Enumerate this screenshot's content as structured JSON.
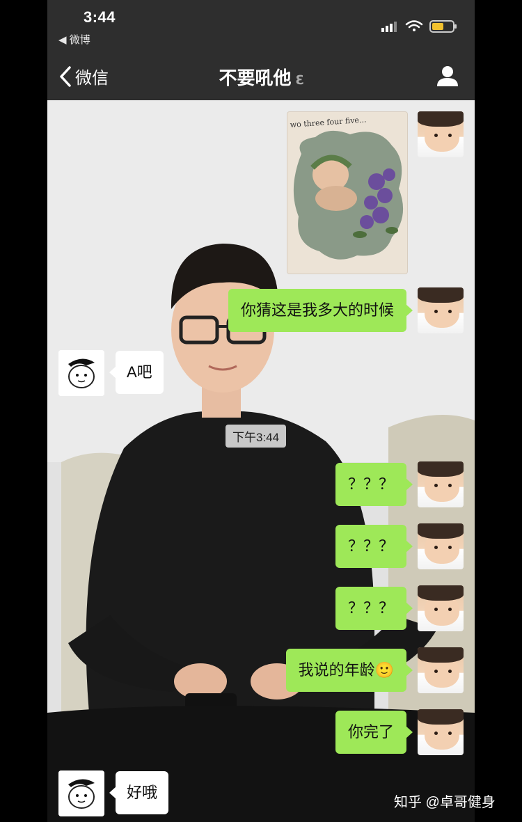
{
  "status_bar": {
    "time": "3:44",
    "back_app": "◀ 微博"
  },
  "nav": {
    "back_label": "微信",
    "chat_title": "不要吼他",
    "title_icon": "ear-icon",
    "right_icon": "profile-icon"
  },
  "photo_message": {
    "caption": "wo three four five..."
  },
  "messages": [
    {
      "side": "right",
      "text": "你猜这是我多大的时候"
    },
    {
      "side": "left",
      "text": "A吧"
    },
    {
      "side": "right",
      "text": "？？？"
    },
    {
      "side": "right",
      "text": "？？？"
    },
    {
      "side": "right",
      "text": "？？？"
    },
    {
      "side": "right",
      "text": "我说的年龄🙂"
    },
    {
      "side": "right",
      "text": "你完了"
    },
    {
      "side": "left",
      "text": "好哦"
    }
  ],
  "timestamp": "下午3:44",
  "watermark": "知乎 @卓哥健身",
  "colors": {
    "bubble_green": "#9ee858",
    "bar_dark": "#2e2e2e"
  }
}
